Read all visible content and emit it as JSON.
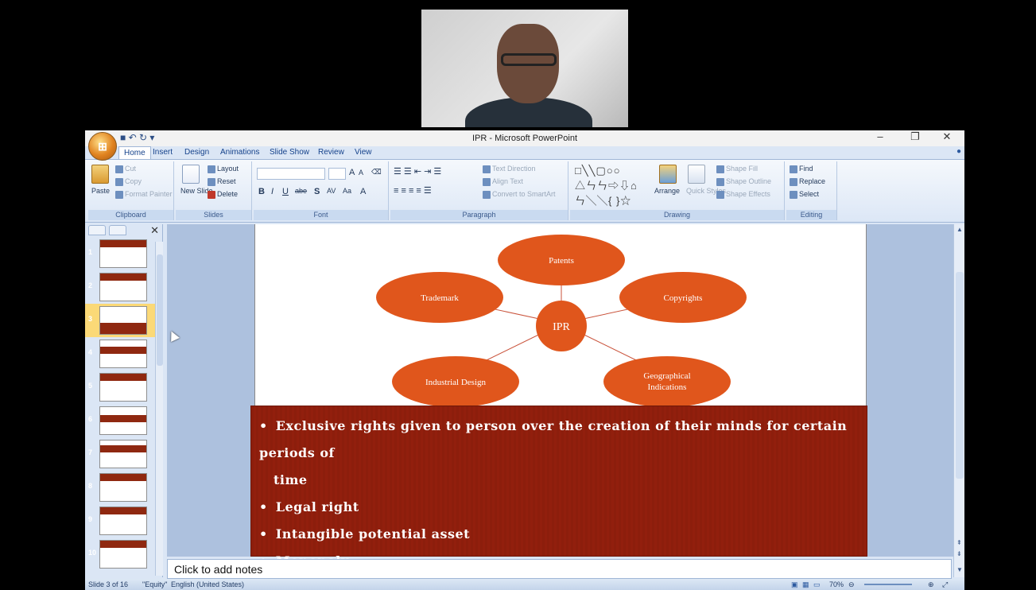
{
  "window": {
    "title": "IPR - Microsoft PowerPoint",
    "controls": [
      "–",
      "❐",
      "✕"
    ]
  },
  "tabs": [
    "Home",
    "Insert",
    "Design",
    "Animations",
    "Slide Show",
    "Review",
    "View"
  ],
  "ribbon": {
    "clipboard": {
      "label": "Clipboard",
      "paste": "Paste",
      "cut": "Cut",
      "copy": "Copy",
      "format_painter": "Format Painter"
    },
    "slides": {
      "label": "Slides",
      "new_slide": "New Slide",
      "layout": "Layout",
      "reset": "Reset",
      "delete": "Delete"
    },
    "font": {
      "label": "Font"
    },
    "paragraph": {
      "label": "Paragraph",
      "text_direction": "Text Direction",
      "align_text": "Align Text",
      "convert_smartart": "Convert to SmartArt"
    },
    "drawing": {
      "label": "Drawing",
      "arrange": "Arrange",
      "quick_styles": "Quick Styles",
      "shape_fill": "Shape Fill",
      "shape_outline": "Shape Outline",
      "shape_effects": "Shape Effects"
    },
    "editing": {
      "label": "Editing",
      "find": "Find",
      "replace": "Replace",
      "select": "Select"
    }
  },
  "thumbnails": [
    "1",
    "2",
    "3",
    "4",
    "5",
    "6",
    "7",
    "8",
    "9",
    "10"
  ],
  "selected_slide": 3,
  "diagram": {
    "center": "IPR",
    "nodes": [
      "Patents",
      "Trademark",
      "Copyrights",
      "Industrial Design",
      "Geographical",
      "Indications"
    ]
  },
  "bullets": [
    "Exclusive rights given to person over the creation of their minds for certain periods of",
    "time",
    "Legal right",
    "Intangible potential asset",
    "Monopoly"
  ],
  "notes_placeholder": "Click to add notes",
  "status": {
    "slide": "Slide 3 of 16",
    "theme": "\"Equity\"",
    "language": "English (United States)",
    "zoom": "70%"
  },
  "colors": {
    "accent": "#e0561c",
    "slide_band": "#8c1e0c"
  }
}
